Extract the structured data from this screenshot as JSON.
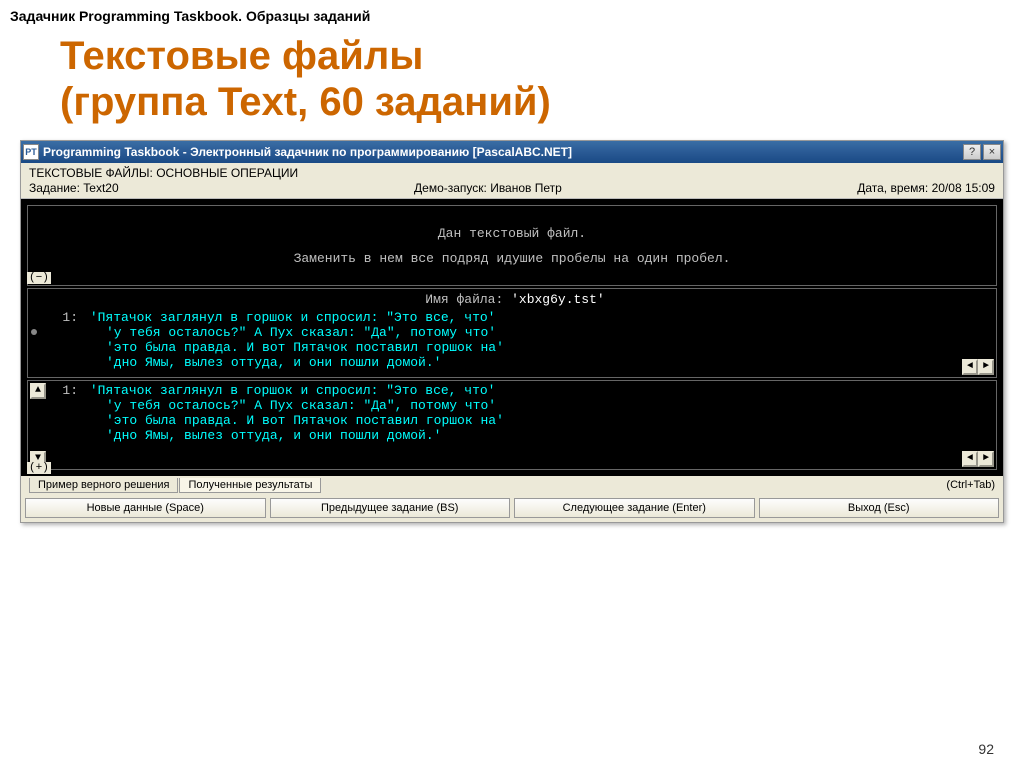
{
  "slide": {
    "header": "Задачник Programming Taskbook. Образцы заданий",
    "title_line1": "Текстовые файлы",
    "title_line2": "(группа Text, 60 заданий)",
    "number": "92"
  },
  "window": {
    "app_icon_label": "PT",
    "title": "Programming Taskbook - Электронный задачник по программированию [PascalABC.NET]",
    "help_btn": "?",
    "close_btn": "×"
  },
  "info": {
    "category": "ТЕКСТОВЫЕ ФАЙЛЫ: ОСНОВНЫЕ ОПЕРАЦИИ",
    "task_label": "Задание: Text20",
    "demo_label": "Демо-запуск: Иванов Петр",
    "datetime_label": "Дата, время: 20/08 15:09"
  },
  "task": {
    "line1": "Дан текстовый файл.",
    "line2": "Заменить в нем все подряд идушие пробелы на один пробел.",
    "left_marker": "(−)"
  },
  "filename": {
    "label": "Имя файла:",
    "value": "'xbxg6y.tst'"
  },
  "input_data": {
    "num": "1:",
    "l1": "'Пятачок заглянул   в   горшок и спросил: \"Это все,  что'",
    "l2": "'у   тебя  осталось?\"  А Пух  сказал:  \"Да\",  потому что'",
    "l3": "'это  была правда.   И   вот Пятачок   поставил  горшок на'",
    "l4": "'дно Ямы,   вылез  оттуда,   и   они пошли домой.'"
  },
  "output_data": {
    "num": "1:",
    "l1": "'Пятачок заглянул в горшок и спросил: \"Это все, что'",
    "l2": "'у тебя осталось?\" А Пух сказал: \"Да\", потому что'",
    "l3": "'это была правда. И вот Пятачок поставил горшок на'",
    "l4": "'дно Ямы, вылез оттуда, и они пошли домой.'",
    "plus_marker": "(+)"
  },
  "tabs": {
    "tab1": "Пример верного решения",
    "tab2": "Полученные результаты",
    "hint": "(Ctrl+Tab)"
  },
  "buttons": {
    "new_data": "Новые данные (Space)",
    "prev": "Предыдущее задание (BS)",
    "next": "Следующее задание (Enter)",
    "exit": "Выход (Esc)"
  }
}
